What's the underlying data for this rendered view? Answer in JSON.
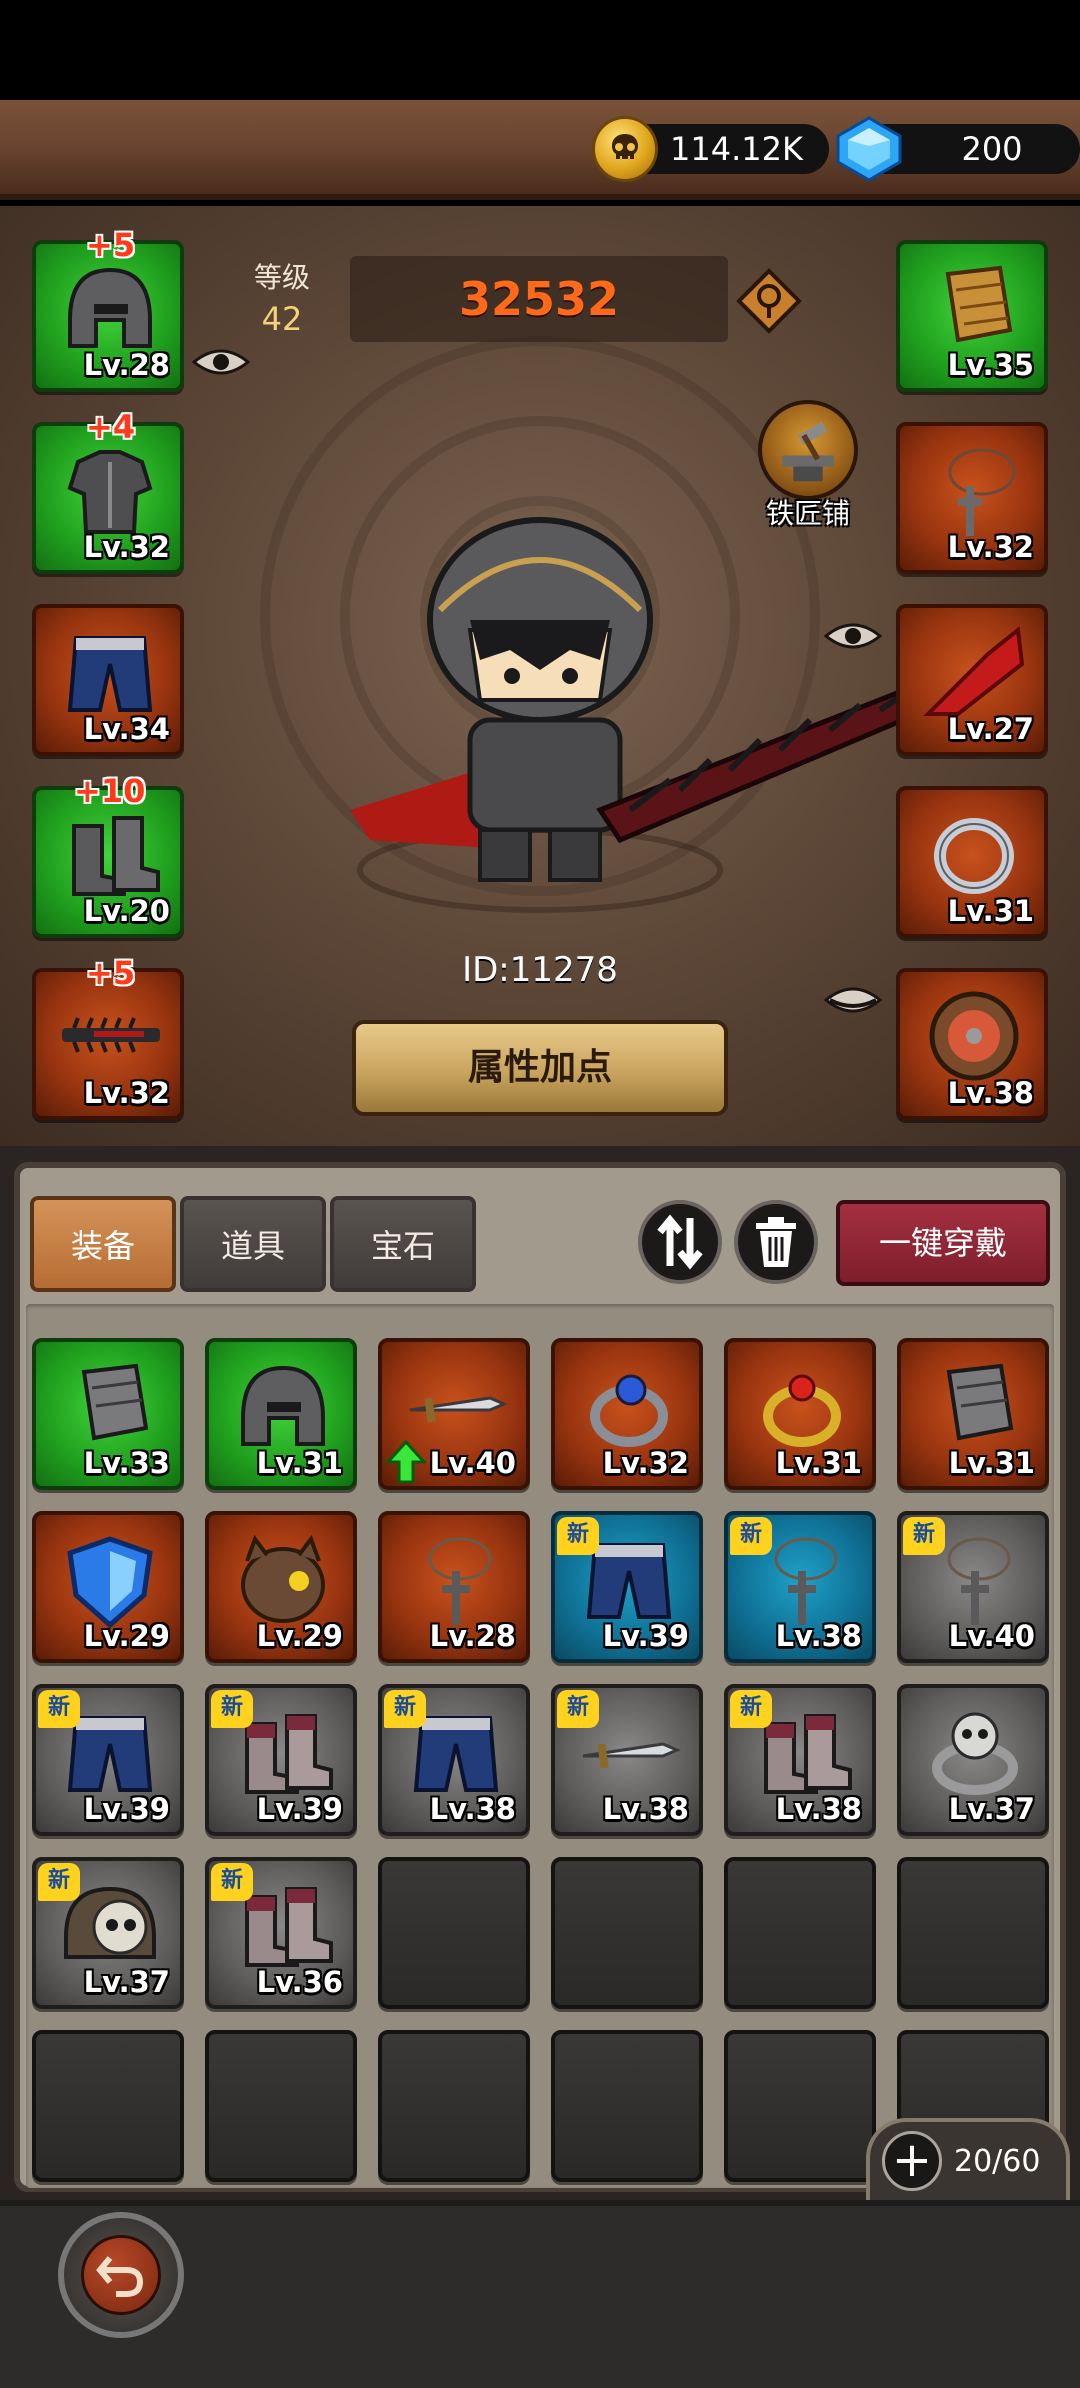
{
  "resources": {
    "gold": "114.12K",
    "gems": "200",
    "gold_icon": "skull-coin-icon",
    "gem_icon": "blue-gem-icon"
  },
  "player": {
    "level_label": "等级",
    "level": "42",
    "power": "32532",
    "id": "ID:11278"
  },
  "blacksmith": {
    "label": "铁匠铺"
  },
  "attr_button": "属性加点",
  "equipped_left": [
    {
      "slot": "helmet",
      "level": "Lv.28",
      "bonus": "+5",
      "rarity": "green",
      "icon": "helmet-icon"
    },
    {
      "slot": "armor",
      "level": "Lv.32",
      "bonus": "+4",
      "rarity": "green",
      "icon": "armor-icon"
    },
    {
      "slot": "pants",
      "level": "Lv.34",
      "bonus": "",
      "rarity": "red",
      "icon": "pants-icon"
    },
    {
      "slot": "boots",
      "level": "Lv.20",
      "bonus": "+10",
      "rarity": "green",
      "icon": "boots-icon"
    },
    {
      "slot": "weapon",
      "level": "Lv.32",
      "bonus": "+5",
      "rarity": "red",
      "icon": "sword-icon"
    }
  ],
  "equipped_right": [
    {
      "slot": "gloves",
      "level": "Lv.35",
      "rarity": "green",
      "icon": "bracer-icon"
    },
    {
      "slot": "necklace",
      "level": "Lv.32",
      "rarity": "red",
      "icon": "necklace-icon"
    },
    {
      "slot": "cape",
      "level": "Lv.27",
      "rarity": "red",
      "icon": "cape-icon"
    },
    {
      "slot": "ring",
      "level": "Lv.31",
      "rarity": "red",
      "icon": "ring-icon"
    },
    {
      "slot": "shield",
      "level": "Lv.38",
      "rarity": "red",
      "icon": "round-shield-icon"
    }
  ],
  "tabs": [
    {
      "label": "装备",
      "active": true
    },
    {
      "label": "道具",
      "active": false
    },
    {
      "label": "宝石",
      "active": false
    }
  ],
  "equip_all": "一键穿戴",
  "new_tag": "新",
  "inventory": [
    {
      "level": "Lv.33",
      "rarity": "green",
      "icon": "bracer-icon",
      "new": false,
      "upgrade": false
    },
    {
      "level": "Lv.31",
      "rarity": "green",
      "icon": "helmet-icon",
      "new": false,
      "upgrade": false
    },
    {
      "level": "Lv.40",
      "rarity": "red",
      "icon": "sword-icon",
      "new": false,
      "upgrade": true
    },
    {
      "level": "Lv.32",
      "rarity": "red",
      "icon": "ring-icon",
      "new": false,
      "upgrade": false
    },
    {
      "level": "Lv.31",
      "rarity": "red",
      "icon": "gold-ring-icon",
      "new": false,
      "upgrade": false
    },
    {
      "level": "Lv.31",
      "rarity": "red",
      "icon": "bracer-icon",
      "new": false,
      "upgrade": false
    },
    {
      "level": "Lv.29",
      "rarity": "red",
      "icon": "kite-shield-icon",
      "new": false,
      "upgrade": false
    },
    {
      "level": "Lv.29",
      "rarity": "red",
      "icon": "beast-helmet-icon",
      "new": false,
      "upgrade": false
    },
    {
      "level": "Lv.28",
      "rarity": "red",
      "icon": "necklace-icon",
      "new": false,
      "upgrade": false
    },
    {
      "level": "Lv.39",
      "rarity": "blue",
      "icon": "pants-icon",
      "new": true,
      "upgrade": false
    },
    {
      "level": "Lv.38",
      "rarity": "blue",
      "icon": "necklace-icon",
      "new": true,
      "upgrade": false
    },
    {
      "level": "Lv.40",
      "rarity": "gray",
      "icon": "necklace-icon",
      "new": true,
      "upgrade": false
    },
    {
      "level": "Lv.39",
      "rarity": "gray",
      "icon": "pants-icon",
      "new": true,
      "upgrade": false
    },
    {
      "level": "Lv.39",
      "rarity": "gray",
      "icon": "boots-icon",
      "new": true,
      "upgrade": false
    },
    {
      "level": "Lv.38",
      "rarity": "gray",
      "icon": "pants-icon",
      "new": true,
      "upgrade": false
    },
    {
      "level": "Lv.38",
      "rarity": "gray",
      "icon": "sword-icon",
      "new": true,
      "upgrade": false
    },
    {
      "level": "Lv.38",
      "rarity": "gray",
      "icon": "boots-icon",
      "new": true,
      "upgrade": false
    },
    {
      "level": "Lv.37",
      "rarity": "gray",
      "icon": "skull-ring-icon",
      "new": false,
      "upgrade": false
    },
    {
      "level": "Lv.37",
      "rarity": "gray",
      "icon": "skull-helmet-icon",
      "new": true,
      "upgrade": false
    },
    {
      "level": "Lv.36",
      "rarity": "gray",
      "icon": "boots-icon",
      "new": true,
      "upgrade": false
    }
  ],
  "capacity": "20/60",
  "colors": {
    "power": "#ff6a1a",
    "bonus": "#ff3a1a",
    "green": "#1f9e1d",
    "red": "#9a3510",
    "blue": "#0f6f93",
    "gray": "#5e5c5a",
    "equip_all": "#a43040"
  }
}
